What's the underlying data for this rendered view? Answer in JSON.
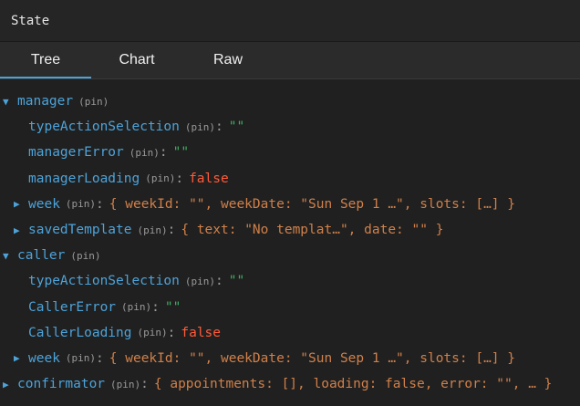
{
  "header": {
    "title": "State"
  },
  "tabs": [
    {
      "label": "Tree",
      "active": true
    },
    {
      "label": "Chart",
      "active": false
    },
    {
      "label": "Raw",
      "active": false
    }
  ],
  "colors": {
    "key": "#4da3d9",
    "string": "#3fae61",
    "boolean": "#ff5b3a",
    "object": "#d0804a"
  },
  "tree": {
    "pin": "(pin)",
    "manager": {
      "key": "manager",
      "arrow": "▼"
    },
    "m_type": {
      "key": "typeActionSelection",
      "value": "\"\""
    },
    "m_error": {
      "key": "managerError",
      "value": "\"\""
    },
    "m_loading": {
      "key": "managerLoading",
      "value": "false"
    },
    "m_week": {
      "key": "week",
      "arrow": "▶",
      "value": "{ weekId: \"\", weekDate: \"Sun Sep 1 …\", slots: […] }"
    },
    "m_saved": {
      "key": "savedTemplate",
      "arrow": "▶",
      "value": "{ text: \"No templat…\", date: \"\" }"
    },
    "caller": {
      "key": "caller",
      "arrow": "▼"
    },
    "c_type": {
      "key": "typeActionSelection",
      "value": "\"\""
    },
    "c_error": {
      "key": "CallerError",
      "value": "\"\""
    },
    "c_loading": {
      "key": "CallerLoading",
      "value": "false"
    },
    "c_week": {
      "key": "week",
      "arrow": "▶",
      "value": "{ weekId: \"\", weekDate: \"Sun Sep 1 …\", slots: […] }"
    },
    "confirmator": {
      "key": "confirmator",
      "arrow": "▶",
      "value": "{ appointments: [], loading: false, error: \"\", … }"
    }
  }
}
